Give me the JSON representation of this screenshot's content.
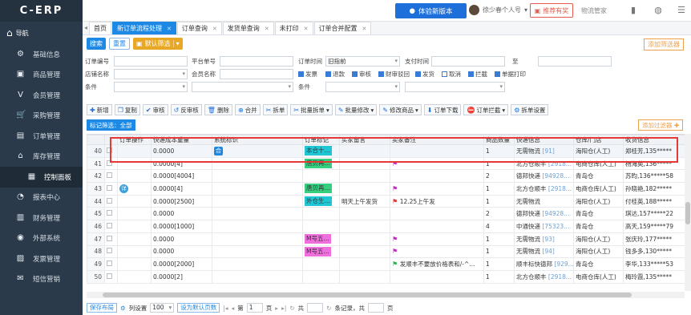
{
  "app": {
    "logo": "C-ERP"
  },
  "sidebar": {
    "toggle_label": "导航",
    "items": [
      {
        "label": "基础信息",
        "icon": "gear-icon",
        "glyph": "⚙"
      },
      {
        "label": "商品管理",
        "icon": "box-icon",
        "glyph": "▣"
      },
      {
        "label": "会员管理",
        "icon": "v-icon",
        "glyph": "V"
      },
      {
        "label": "采购管理",
        "icon": "cart-icon",
        "glyph": "🛒"
      },
      {
        "label": "订单管理",
        "icon": "clipboard-icon",
        "glyph": "▤"
      },
      {
        "label": "库存管理",
        "icon": "warehouse-icon",
        "glyph": "⌂"
      },
      {
        "label": "控制面板",
        "icon": "dashboard-icon",
        "glyph": "▦",
        "sub": true
      },
      {
        "label": "报表中心",
        "icon": "chart-icon",
        "glyph": "◔"
      },
      {
        "label": "财务管理",
        "icon": "wallet-icon",
        "glyph": "▥"
      },
      {
        "label": "外部系统",
        "icon": "globe-icon",
        "glyph": "◉"
      },
      {
        "label": "发票管理",
        "icon": "invoice-icon",
        "glyph": "▨"
      },
      {
        "label": "短信营销",
        "icon": "message-icon",
        "glyph": "✉"
      }
    ]
  },
  "topbar": {
    "new_version": "体验新版本",
    "user_name": "徐少春个人号",
    "recommend": "推荐有奖",
    "logistics": "物流管家"
  },
  "tabs": [
    {
      "label": "首页",
      "closable": false,
      "active": false
    },
    {
      "label": "新订单流程处理",
      "closable": true,
      "active": true
    },
    {
      "label": "订单查询",
      "closable": true,
      "active": false
    },
    {
      "label": "发货单查询",
      "closable": true,
      "active": false
    },
    {
      "label": "未打印",
      "closable": true,
      "active": false
    },
    {
      "label": "订单合并配置",
      "closable": true,
      "active": false
    }
  ],
  "toolbar1": {
    "search": "搜索",
    "reset": "重置",
    "default_filter": "默认筛选",
    "add_filter": "添加筛选器"
  },
  "filters": {
    "order_no": "订单编号",
    "platform_no": "平台单号",
    "order_time": "订单时间",
    "order_time_value": "旧指前",
    "pay_time": "支付时间",
    "to": "至",
    "shop_name": "店铺名称",
    "member_name": "会员名称",
    "condition": "条件",
    "checkboxes": [
      "发票",
      "退款",
      "审核",
      "财审驳回",
      "发货",
      "取消",
      "拦截",
      "单据打印"
    ]
  },
  "toolbar2": [
    {
      "label": "新增",
      "glyph": "✚",
      "dropdown": false
    },
    {
      "label": "复制",
      "glyph": "❐",
      "dropdown": false
    },
    {
      "label": "审核",
      "glyph": "✔",
      "dropdown": false
    },
    {
      "label": "反审核",
      "glyph": "↺",
      "dropdown": false
    },
    {
      "label": "删除",
      "glyph": "🗑",
      "dropdown": false
    },
    {
      "label": "合并",
      "glyph": "⊕",
      "dropdown": false
    },
    {
      "label": "拆单",
      "glyph": "✂",
      "dropdown": false
    },
    {
      "label": "批量拆单",
      "glyph": "✂",
      "dropdown": true
    },
    {
      "label": "批量修改",
      "glyph": "✎",
      "dropdown": true
    },
    {
      "label": "修改商品",
      "glyph": "✎",
      "dropdown": true
    },
    {
      "label": "订单下载",
      "glyph": "⬇",
      "dropdown": false
    },
    {
      "label": "订单拦截",
      "glyph": "⛔",
      "dropdown": true
    },
    {
      "label": "拆单设置",
      "glyph": "⚙",
      "dropdown": false
    }
  ],
  "mark_filter": "标记筛选：全部",
  "add_filter2": "添加过滤器",
  "grid": {
    "headers": [
      "",
      "",
      "订单操作",
      "快递成本重量",
      "系统标识",
      "订单标记",
      "买家留言",
      "卖家备注",
      "商品数量",
      "快递信息",
      "仓库/门店",
      "收货信息"
    ],
    "rows": [
      {
        "n": "40",
        "op": "",
        "weight": "0.0000",
        "sys": "合",
        "mark": "本合十...",
        "mark_color": "cyan",
        "buyer": "",
        "seller": "",
        "seller_flag": "",
        "qty": "1",
        "express": "无需物流",
        "express_code": "[91]",
        "wh": "海阳仓(人工)",
        "recv": "郑桂芳,135*****"
      },
      {
        "n": "41",
        "op": "",
        "weight": "0.0000[4]",
        "sys": "",
        "mark": "唐贝再...",
        "mark_color": "green",
        "buyer": "",
        "seller": "",
        "seller_flag": "purple",
        "qty": "1",
        "express": "北方仓顺丰",
        "express_code": "[2918...",
        "wh": "电商仓库(人工)",
        "recv": "杨海英,136*****"
      },
      {
        "n": "42",
        "op": "",
        "weight": "0.0000[4004]",
        "sys": "",
        "mark": "",
        "mark_color": "",
        "buyer": "",
        "seller": "",
        "seller_flag": "",
        "qty": "2",
        "express": "德邦快递",
        "express_code": "[94928...",
        "wh": "青岛仓",
        "recv": "苏昀,136*****58"
      },
      {
        "n": "43",
        "op": "详",
        "weight": "0.0000[4]",
        "sys": "",
        "mark": "唐贝再...",
        "mark_color": "green",
        "buyer": "",
        "seller": "",
        "seller_flag": "purple",
        "qty": "1",
        "express": "北方仓顺丰",
        "express_code": "[2918...",
        "wh": "电商仓库(人工)",
        "recv": "孙晓艳,182*****"
      },
      {
        "n": "44",
        "op": "",
        "weight": "0.0000[2500]",
        "sys": "",
        "mark": "外仓生...",
        "mark_color": "cyan",
        "buyer": "明天上午发货",
        "seller": "12.25上午发",
        "seller_flag": "red",
        "qty": "1",
        "express": "无需物流",
        "express_code": "",
        "wh": "海阳仓(人工)",
        "recv": "付桂英,188*****"
      },
      {
        "n": "45",
        "op": "",
        "weight": "0.0000",
        "sys": "",
        "mark": "",
        "mark_color": "",
        "buyer": "",
        "seller": "",
        "seller_flag": "",
        "qty": "2",
        "express": "德邦快递",
        "express_code": "[94928...",
        "wh": "青岛仓",
        "recv": "琪达,157*****22"
      },
      {
        "n": "46",
        "op": "",
        "weight": "0.0000[1000]",
        "sys": "",
        "mark": "",
        "mark_color": "",
        "buyer": "",
        "seller": "",
        "seller_flag": "",
        "qty": "4",
        "express": "中通快递",
        "express_code": "[75323...",
        "wh": "青岛仓",
        "recv": "高天,159*****79"
      },
      {
        "n": "47",
        "op": "",
        "weight": "0.0000",
        "sys": "",
        "mark": "M号五...",
        "mark_color": "pink",
        "buyer": "",
        "seller": "",
        "seller_flag": "purple",
        "qty": "1",
        "express": "无需物流",
        "express_code": "[93]",
        "wh": "海阳仓(人工)",
        "recv": "张庆玲,177*****"
      },
      {
        "n": "48",
        "op": "",
        "weight": "0.0000",
        "sys": "",
        "mark": "M号五...",
        "mark_color": "pink",
        "buyer": "",
        "seller": "",
        "seller_flag": "purple",
        "qty": "1",
        "express": "无需物流",
        "express_code": "[94]",
        "wh": "海阳仓(人工)",
        "recv": "钱多多,130*****"
      },
      {
        "n": "49",
        "op": "",
        "weight": "0.0000[2000]",
        "sys": "",
        "mark": "",
        "mark_color": "",
        "buyer": "",
        "seller": "发顺丰不要放价格表和/-^...",
        "seller_flag": "green",
        "qty": "1",
        "express": "顺丰标快德邦",
        "express_code": "[929...",
        "wh": "青岛仓",
        "recv": "李华,133*****53"
      },
      {
        "n": "50",
        "op": "",
        "weight": "0.0000[2]",
        "sys": "",
        "mark": "",
        "mark_color": "",
        "buyer": "",
        "seller": "",
        "seller_flag": "",
        "qty": "1",
        "express": "北方仓顺丰",
        "express_code": "[2918...",
        "wh": "电商仓库(人工)",
        "recv": "梅玲霞,135*****"
      }
    ]
  },
  "footer": {
    "save_layout": "保存布局",
    "column_settings": "列设置",
    "page_size": "100",
    "set_default": "设为默认页数",
    "page_label": "第",
    "page_value": "1",
    "page_unit": "页",
    "total_label": "共",
    "records_label": "条记录，共",
    "pages_unit": "页"
  }
}
